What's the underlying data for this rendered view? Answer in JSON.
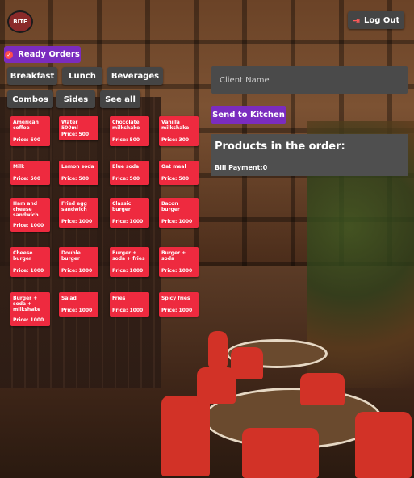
{
  "header": {
    "logo_text": "BITE",
    "logout_label": "Log Out"
  },
  "ready_orders_label": "Ready Orders",
  "categories": [
    "Breakfast",
    "Lunch",
    "Beverages",
    "Combos",
    "Sides",
    "See all"
  ],
  "products": [
    {
      "name": "American coffee",
      "price": "Price: 600"
    },
    {
      "name": "Water 500ml",
      "price": "Price: 500"
    },
    {
      "name": "Chocolate milkshake",
      "price": "Price: 500"
    },
    {
      "name": "Vanilla milkshake",
      "price": "Price: 300"
    },
    {
      "name": "Milk",
      "price": "Price: 500"
    },
    {
      "name": "Lemon soda",
      "price": "Price: 500"
    },
    {
      "name": "Blue soda",
      "price": "Price: 500"
    },
    {
      "name": "Oat meal",
      "price": "Price: 500"
    },
    {
      "name": "Ham and cheese sandwich",
      "price": "Price: 1000"
    },
    {
      "name": "Fried egg sandwich",
      "price": "Price: 1000"
    },
    {
      "name": "Classic burger",
      "price": "Price: 1000"
    },
    {
      "name": "Bacon burger",
      "price": "Price: 1000"
    },
    {
      "name": "Cheese burger",
      "price": "Price: 1000"
    },
    {
      "name": "Double burger",
      "price": "Price: 1000"
    },
    {
      "name": "Burger + soda + fries",
      "price": "Price: 1000"
    },
    {
      "name": "Burger + soda",
      "price": "Price: 1000"
    },
    {
      "name": "Burger + soda + milkshake",
      "price": "Price: 1000"
    },
    {
      "name": "Salad",
      "price": "Price: 1000"
    },
    {
      "name": "Fries",
      "price": "Price: 1000"
    },
    {
      "name": "Spicy fries",
      "price": "Price: 1000"
    }
  ],
  "order": {
    "client_placeholder": "Client Name",
    "send_label": "Send to Kitchen",
    "title": "Products in the order:",
    "bill": "Bill Payment:0"
  },
  "colors": {
    "accent": "#7b2cbf",
    "card": "#ee2a3f",
    "button": "#454545"
  },
  "icons": {
    "logout": "logout-icon",
    "ready": "check-circle-icon"
  }
}
